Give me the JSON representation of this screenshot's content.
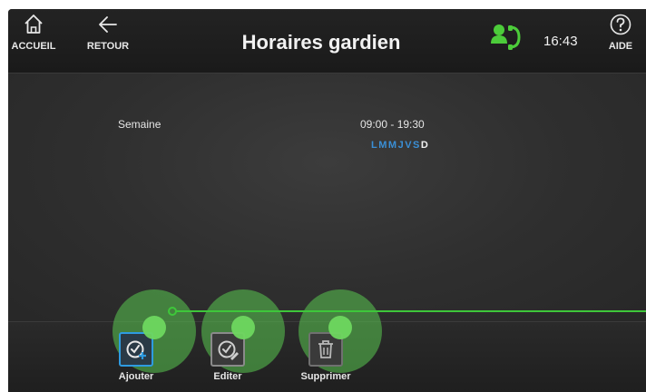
{
  "header": {
    "home_label": "ACCUEIL",
    "back_label": "RETOUR",
    "title": "Horaires gardien",
    "time": "16:43",
    "help_label": "AIDE"
  },
  "schedule": {
    "label": "Semaine",
    "time_range": "09:00 - 19:30",
    "days": [
      {
        "letter": "L",
        "active": true
      },
      {
        "letter": "M",
        "active": true
      },
      {
        "letter": "M",
        "active": true
      },
      {
        "letter": "J",
        "active": true
      },
      {
        "letter": "V",
        "active": true
      },
      {
        "letter": "S",
        "active": true
      },
      {
        "letter": "D",
        "active": false
      }
    ]
  },
  "toolbar": {
    "add_label": "Ajouter",
    "edit_label": "Editer",
    "delete_label": "Supprimer"
  },
  "colors": {
    "accent_blue": "#2e9be0",
    "day_active": "#3a8fd6",
    "status_green": "#4ccc3a",
    "touch_green": "#5ac850"
  },
  "icons": {
    "home": "home-icon",
    "back": "arrow-left-icon",
    "status": "concierge-phone-icon",
    "help": "question-circle-icon",
    "add": "calendar-check-add-icon",
    "edit": "calendar-check-edit-icon",
    "delete": "trash-icon"
  }
}
